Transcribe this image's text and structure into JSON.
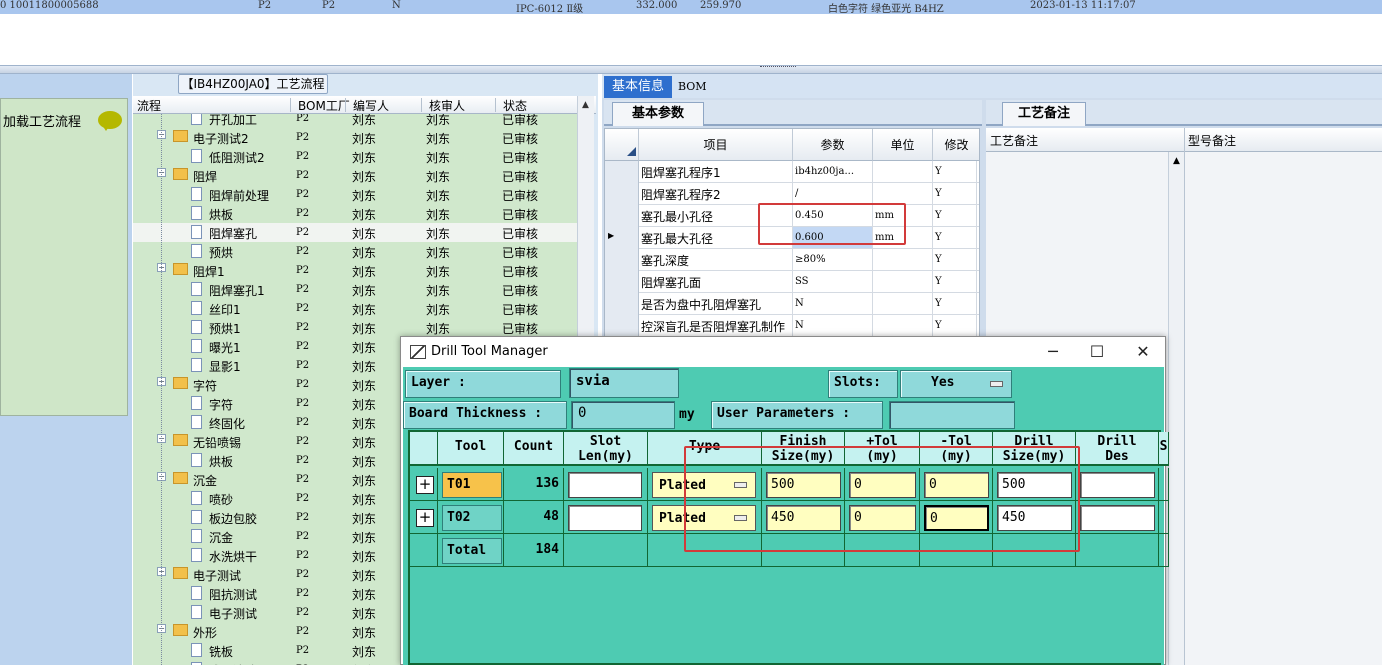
{
  "top_row": {
    "id": "0  10011800005688",
    "p1": "P2",
    "p2": "P2",
    "flag": "N",
    "std": "IPC-6012 Ⅱ级",
    "v1": "332.000",
    "v2": "259.970",
    "text": "白色字符  绿色亚光  B4HZ",
    "datetime": "2023-01-13 11:17:07"
  },
  "left_panel": {
    "load_label": "加载工艺流程",
    "chat_icon": "speech-bubble-icon"
  },
  "tree": {
    "title": "【IB4HZ00JA0】工艺流程",
    "headers": [
      "流程",
      "BOM工厂",
      "编写人",
      "核审人",
      "状态"
    ],
    "rows": [
      {
        "indent": 2,
        "kind": "doc",
        "name": "开孔加工",
        "bom": "P2",
        "writer": "刘东",
        "reviewer": "刘东",
        "status": "已审核",
        "cut": true
      },
      {
        "indent": 1,
        "kind": "folder",
        "name": "电子测试2",
        "bom": "P2",
        "writer": "刘东",
        "reviewer": "刘东",
        "status": "已审核"
      },
      {
        "indent": 2,
        "kind": "doc",
        "name": "低阻测试2",
        "bom": "P2",
        "writer": "刘东",
        "reviewer": "刘东",
        "status": "已审核"
      },
      {
        "indent": 1,
        "kind": "folder",
        "name": "阻焊",
        "bom": "P2",
        "writer": "刘东",
        "reviewer": "刘东",
        "status": "已审核"
      },
      {
        "indent": 2,
        "kind": "doc",
        "name": "阻焊前处理",
        "bom": "P2",
        "writer": "刘东",
        "reviewer": "刘东",
        "status": "已审核"
      },
      {
        "indent": 2,
        "kind": "doc",
        "name": "烘板",
        "bom": "P2",
        "writer": "刘东",
        "reviewer": "刘东",
        "status": "已审核"
      },
      {
        "indent": 2,
        "kind": "doc",
        "name": "阻焊塞孔",
        "bom": "P2",
        "writer": "刘东",
        "reviewer": "刘东",
        "status": "已审核",
        "selected": true
      },
      {
        "indent": 2,
        "kind": "doc",
        "name": "预烘",
        "bom": "P2",
        "writer": "刘东",
        "reviewer": "刘东",
        "status": "已审核"
      },
      {
        "indent": 1,
        "kind": "folder",
        "name": "阻焊1",
        "bom": "P2",
        "writer": "刘东",
        "reviewer": "刘东",
        "status": "已审核"
      },
      {
        "indent": 2,
        "kind": "doc",
        "name": "阻焊塞孔1",
        "bom": "P2",
        "writer": "刘东",
        "reviewer": "刘东",
        "status": "已审核"
      },
      {
        "indent": 2,
        "kind": "doc",
        "name": "丝印1",
        "bom": "P2",
        "writer": "刘东",
        "reviewer": "刘东",
        "status": "已审核"
      },
      {
        "indent": 2,
        "kind": "doc",
        "name": "预烘1",
        "bom": "P2",
        "writer": "刘东",
        "reviewer": "刘东",
        "status": "已审核"
      },
      {
        "indent": 2,
        "kind": "doc",
        "name": "曝光1",
        "bom": "P2",
        "writer": "刘东",
        "reviewer": "",
        "status": ""
      },
      {
        "indent": 2,
        "kind": "doc",
        "name": "显影1",
        "bom": "P2",
        "writer": "刘东",
        "reviewer": "",
        "status": ""
      },
      {
        "indent": 1,
        "kind": "folder",
        "name": "字符",
        "bom": "P2",
        "writer": "刘东",
        "reviewer": "",
        "status": ""
      },
      {
        "indent": 2,
        "kind": "doc",
        "name": "字符",
        "bom": "P2",
        "writer": "刘东",
        "reviewer": "",
        "status": ""
      },
      {
        "indent": 2,
        "kind": "doc",
        "name": "终固化",
        "bom": "P2",
        "writer": "刘东",
        "reviewer": "",
        "status": ""
      },
      {
        "indent": 1,
        "kind": "folder",
        "name": "无铅喷锡",
        "bom": "P2",
        "writer": "刘东",
        "reviewer": "",
        "status": ""
      },
      {
        "indent": 2,
        "kind": "doc",
        "name": "烘板",
        "bom": "P2",
        "writer": "刘东",
        "reviewer": "",
        "status": ""
      },
      {
        "indent": 1,
        "kind": "folder",
        "name": "沉金",
        "bom": "P2",
        "writer": "刘东",
        "reviewer": "",
        "status": ""
      },
      {
        "indent": 2,
        "kind": "doc",
        "name": "喷砂",
        "bom": "P2",
        "writer": "刘东",
        "reviewer": "",
        "status": ""
      },
      {
        "indent": 2,
        "kind": "doc",
        "name": "板边包胶",
        "bom": "P2",
        "writer": "刘东",
        "reviewer": "",
        "status": ""
      },
      {
        "indent": 2,
        "kind": "doc",
        "name": "沉金",
        "bom": "P2",
        "writer": "刘东",
        "reviewer": "",
        "status": ""
      },
      {
        "indent": 2,
        "kind": "doc",
        "name": "水洗烘干",
        "bom": "P2",
        "writer": "刘东",
        "reviewer": "",
        "status": ""
      },
      {
        "indent": 1,
        "kind": "folder",
        "name": "电子测试",
        "bom": "P2",
        "writer": "刘东",
        "reviewer": "",
        "status": ""
      },
      {
        "indent": 2,
        "kind": "doc",
        "name": "阻抗测试",
        "bom": "P2",
        "writer": "刘东",
        "reviewer": "",
        "status": ""
      },
      {
        "indent": 2,
        "kind": "doc",
        "name": "电子测试",
        "bom": "P2",
        "writer": "刘东",
        "reviewer": "",
        "status": ""
      },
      {
        "indent": 1,
        "kind": "folder",
        "name": "外形",
        "bom": "P2",
        "writer": "刘东",
        "reviewer": "",
        "status": ""
      },
      {
        "indent": 2,
        "kind": "doc",
        "name": "铣板",
        "bom": "P2",
        "writer": "刘东",
        "reviewer": "",
        "status": ""
      },
      {
        "indent": 2,
        "kind": "doc",
        "name": "成品清洗",
        "bom": "P2",
        "writer": "刘东",
        "reviewer": "",
        "status": "",
        "cut": true
      }
    ]
  },
  "right": {
    "tabs": [
      "基本信息",
      "BOM"
    ],
    "param_tab": "基本参数",
    "remark_tab": "工艺备注",
    "param_headers": [
      "项目",
      "参数",
      "单位",
      "修改"
    ],
    "params": [
      {
        "item": "阻焊塞孔程序1",
        "value": "ib4hz00ja...",
        "unit": "",
        "mod": "Y"
      },
      {
        "item": "阻焊塞孔程序2",
        "value": "/",
        "unit": "",
        "mod": "Y"
      },
      {
        "item": "塞孔最小孔径",
        "value": "0.450",
        "unit": "mm",
        "mod": "Y"
      },
      {
        "item": "塞孔最大孔径",
        "value": "0.600",
        "unit": "mm",
        "mod": "Y",
        "current": true
      },
      {
        "item": "塞孔深度",
        "value": "≥80%",
        "unit": "",
        "mod": "Y"
      },
      {
        "item": "阻焊塞孔面",
        "value": "SS",
        "unit": "",
        "mod": "Y"
      },
      {
        "item": "是否为盘中孔阻焊塞孔",
        "value": "N",
        "unit": "",
        "mod": "Y"
      },
      {
        "item": "控深盲孔是否阻焊塞孔制作",
        "value": "N",
        "unit": "",
        "mod": "Y"
      }
    ],
    "remark_headers": [
      "工艺备注",
      "型号备注"
    ]
  },
  "dialog": {
    "title": "Drill Tool Manager",
    "layer_label": "Layer          :",
    "layer_value": "svia",
    "slots_label": "Slots:",
    "slots_value": "Yes",
    "thickness_label": "Board Thickness :",
    "thickness_value": "0",
    "thickness_unit": "my",
    "user_params_label": "User Parameters :",
    "user_params_value": "",
    "headers": [
      {
        "l1": "",
        "l2": ""
      },
      {
        "l1": "Tool",
        "l2": ""
      },
      {
        "l1": "Count",
        "l2": ""
      },
      {
        "l1": "Slot",
        "l2": "Len(my)"
      },
      {
        "l1": "Type",
        "l2": ""
      },
      {
        "l1": "Finish",
        "l2": "Size(my)"
      },
      {
        "l1": "+Tol",
        "l2": "(my)"
      },
      {
        "l1": "-Tol",
        "l2": "(my)"
      },
      {
        "l1": "Drill",
        "l2": "Size(my)"
      },
      {
        "l1": "Drill",
        "l2": "Des"
      },
      {
        "l1": "S",
        "l2": ""
      }
    ],
    "tools": [
      {
        "tool": "T01",
        "count": "136",
        "slot_len": "",
        "type": "Plated",
        "finish": "500",
        "plus_tol": "0",
        "minus_tol": "0",
        "drill": "500",
        "drill_des": ""
      },
      {
        "tool": "T02",
        "count": "48",
        "slot_len": "",
        "type": "Plated",
        "finish": "450",
        "plus_tol": "0",
        "minus_tol": "0",
        "drill": "450",
        "drill_des": ""
      }
    ],
    "total_label": "Total",
    "total_count": "184"
  },
  "colors": {
    "dialog_bg": "#4ecbb2",
    "tree_bg": "#d0e8cc",
    "highlight_red": "#d23a3a",
    "tab_active": "#2e6fce"
  }
}
